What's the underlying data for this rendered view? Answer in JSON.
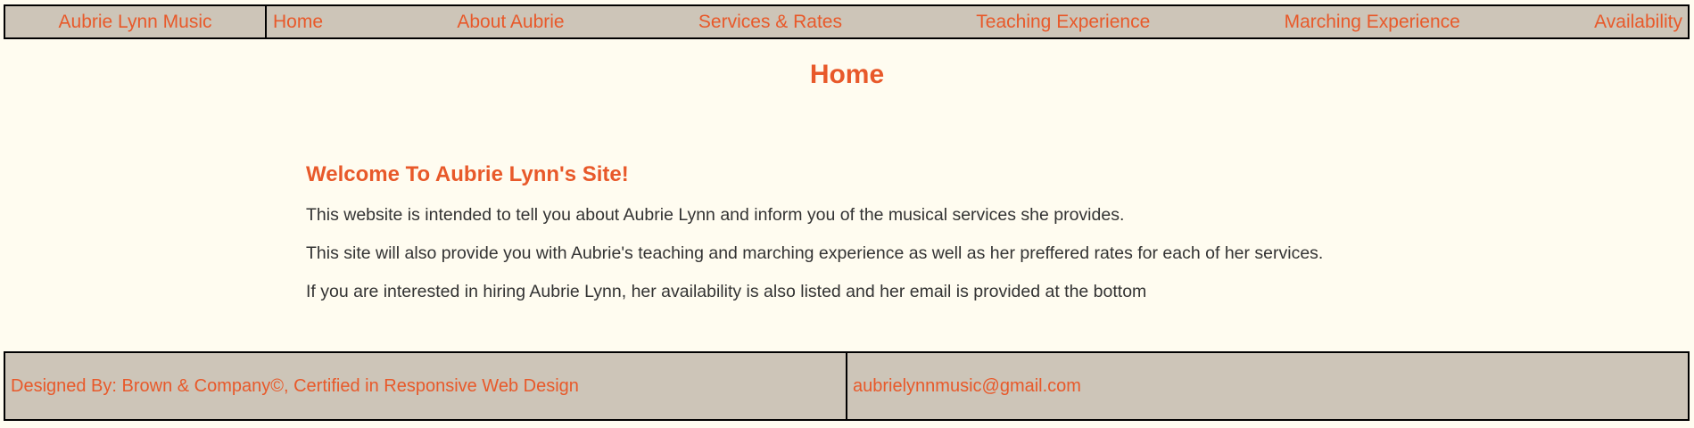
{
  "nav": {
    "brand": "Aubrie Lynn Music",
    "items": [
      {
        "label": "Home"
      },
      {
        "label": "About Aubrie"
      },
      {
        "label": "Services & Rates"
      },
      {
        "label": "Teaching Experience"
      },
      {
        "label": "Marching Experience"
      },
      {
        "label": "Availability"
      }
    ]
  },
  "main": {
    "title": "Home",
    "welcome": "Welcome To Aubrie Lynn's Site!",
    "paragraphs": [
      "This website is intended to tell you about Aubrie Lynn and inform you of the musical services she provides.",
      "This site will also provide you with Aubrie's teaching and marching experience as well as her preffered rates for each of her services.",
      "If you are interested in hiring Aubrie Lynn, her availability is also listed and her email is provided at the bottom"
    ]
  },
  "footer": {
    "credit": "Designed By: Brown & Company©, Certified in Responsive Web Design",
    "email": "aubrielynnmusic@gmail.com"
  },
  "colors": {
    "background": "#fffcf0",
    "bar": "#cdc5b8",
    "accent": "#e8592a",
    "text": "#333333"
  }
}
